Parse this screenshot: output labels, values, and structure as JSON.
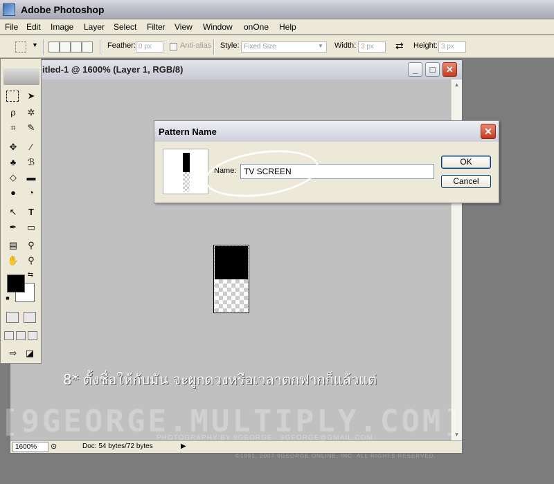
{
  "app": {
    "title": "Adobe Photoshop"
  },
  "menu": [
    "File",
    "Edit",
    "Image",
    "Layer",
    "Select",
    "Filter",
    "View",
    "Window",
    "onOne",
    "Help"
  ],
  "options_bar": {
    "feather_label": "Feather:",
    "feather_value": "0 px",
    "antialias_label": "Anti-alias",
    "style_label": "Style:",
    "style_value": "Fixed Size",
    "width_label": "Width:",
    "width_value": "3 px",
    "height_label": "Height:",
    "height_value": "3 px"
  },
  "document": {
    "title": "itled-1 @ 1600% (Layer 1, RGB/8)",
    "zoom": "1600%",
    "doc_info": "Doc: 54 bytes/72 bytes"
  },
  "dialog": {
    "title": "Pattern Name",
    "name_label": "Name:",
    "name_value": "TV SCREEN",
    "ok_label": "OK",
    "cancel_label": "Cancel"
  },
  "caption": "8* ตั้งชื่อให้กับมัน จะผูกดวงหรือเวลาตกฟากก็แล้วแต่",
  "watermark": {
    "main": "[9GEORGE.MULTIPLY.COM]",
    "credit": "PHOTOGRAPHY BY 9GEORGE : 9GEORGE@GMAIL.COM",
    "copyright": "©1991, 2007 9GEORGE ONLINE, INC. ALL RIGHTS RESERVED."
  },
  "colors": {
    "foreground": "#000000",
    "background": "#ffffff",
    "accent_close": "#c43b1d"
  }
}
